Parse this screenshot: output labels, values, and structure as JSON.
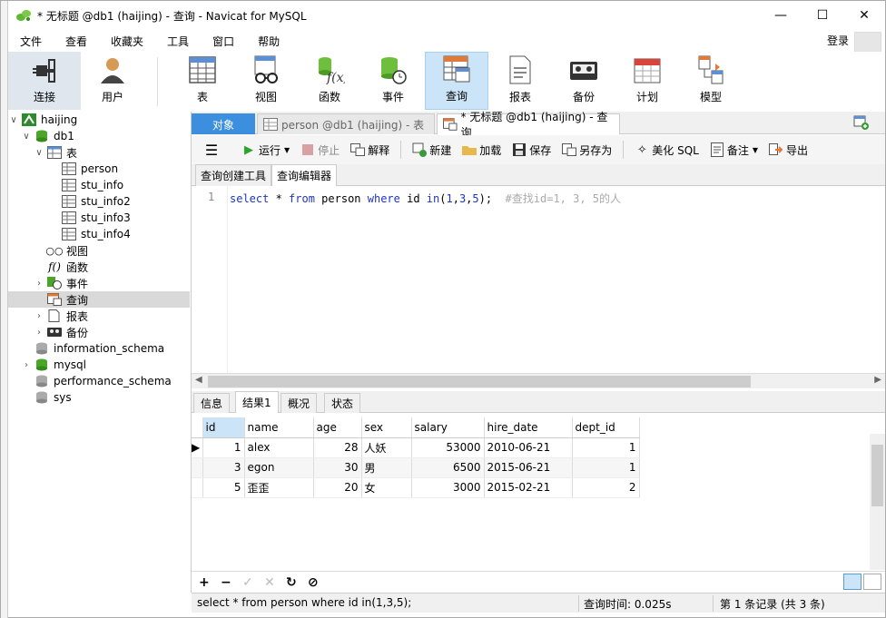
{
  "window": {
    "title": "* 无标题 @db1 (haijing) - 查询 - Navicat for MySQL"
  },
  "menu": {
    "items": [
      "文件",
      "查看",
      "收藏夹",
      "工具",
      "窗口",
      "帮助"
    ],
    "login": "登录"
  },
  "toolbar": {
    "connect": "连接",
    "user": "用户",
    "table": "表",
    "view": "视图",
    "function": "函数",
    "event": "事件",
    "query": "查询",
    "report": "报表",
    "backup": "备份",
    "schedule": "计划",
    "model": "模型"
  },
  "tree": {
    "connection": "haijing",
    "db": "db1",
    "tables_folder": "表",
    "tables": [
      "person",
      "stu_info",
      "stu_info2",
      "stu_info3",
      "stu_info4"
    ],
    "views": "视图",
    "functions": "函数",
    "events": "事件",
    "queries": "查询",
    "reports": "报表",
    "backups": "备份",
    "other_dbs": [
      "information_schema",
      "mysql",
      "performance_schema",
      "sys"
    ]
  },
  "tabs": {
    "objects": "对象",
    "tab1": "person @db1 (haijing) - 表",
    "tab2": "* 无标题 @db1 (haijing) - 查询"
  },
  "qtoolbar": {
    "run": "运行",
    "stop": "停止",
    "explain": "解释",
    "new": "新建",
    "load": "加载",
    "save": "保存",
    "save_as": "另存为",
    "beautify": "美化 SQL",
    "note": "备注",
    "export": "导出"
  },
  "subtabs": {
    "builder": "查询创建工具",
    "editor": "查询编辑器"
  },
  "editor": {
    "line_no": "1",
    "kw_select": "select",
    "star": " * ",
    "kw_from": "from",
    "table": " person ",
    "kw_where": "where",
    "col": " id ",
    "kw_in": "in",
    "open": "(",
    "n1": "1",
    "c1": ",",
    "n3": "3",
    "c2": ",",
    "n5": "5",
    "close": ");",
    "comment": "  #查找id=1, 3, 5的人"
  },
  "result_tabs": {
    "info": "信息",
    "result": "结果1",
    "profile": "概况",
    "status": "状态"
  },
  "grid": {
    "columns": [
      "id",
      "name",
      "age",
      "sex",
      "salary",
      "hire_date",
      "dept_id"
    ],
    "rows": [
      [
        "1",
        "alex",
        "28",
        "人妖",
        "53000",
        "2010-06-21",
        "1"
      ],
      [
        "3",
        "egon",
        "30",
        "男",
        "6500",
        "2015-06-21",
        "1"
      ],
      [
        "5",
        "歪歪",
        "20",
        "女",
        "3000",
        "2015-02-21",
        "2"
      ]
    ]
  },
  "gridbar": {
    "add": "+",
    "remove": "−",
    "apply": "✓",
    "discard": "✕",
    "refresh": "↻",
    "stop": "⊘"
  },
  "status": {
    "sql": "select * from person where id in(1,3,5);",
    "query_time": "查询时间: 0.025s",
    "record": "第 1 条记录 (共 3 条)"
  },
  "colors": {
    "accent": "#3c8fde",
    "keyword": "#1e34c8",
    "selected_tool": "#cce4f7"
  }
}
